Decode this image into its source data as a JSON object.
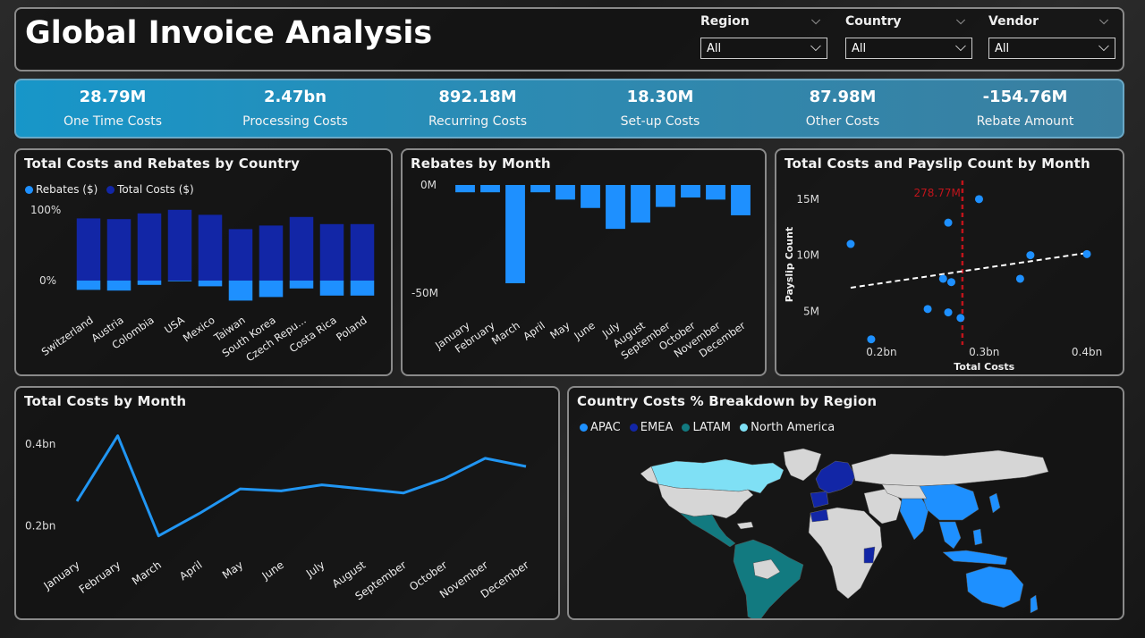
{
  "header": {
    "title": "Global Invoice Analysis",
    "slicers": [
      {
        "label": "Region",
        "value": "All"
      },
      {
        "label": "Country",
        "value": "All"
      },
      {
        "label": "Vendor",
        "value": "All"
      }
    ]
  },
  "kpis": [
    {
      "value": "28.79M",
      "label": "One Time Costs"
    },
    {
      "value": "2.47bn",
      "label": "Processing Costs"
    },
    {
      "value": "892.18M",
      "label": "Recurring Costs"
    },
    {
      "value": "18.30M",
      "label": "Set-up Costs"
    },
    {
      "value": "87.98M",
      "label": "Other Costs"
    },
    {
      "value": "-154.76M",
      "label": "Rebate Amount"
    }
  ],
  "colors": {
    "total_costs": "#1226a6",
    "rebates": "#1e90ff",
    "line": "#2196f3",
    "apac": "#1e90ff",
    "emea": "#1226a6",
    "latam": "#127a80",
    "north_america": "#7fe0f5",
    "reference_line": "#c0141b"
  },
  "chart_data": [
    {
      "type": "bar",
      "subtype": "stacked-percent",
      "title": "Total Costs and Rebates by Country",
      "categories": [
        "Switzerland",
        "Austria",
        "Colombia",
        "USA",
        "Mexico",
        "Taiwan",
        "South Korea",
        "Czech Repu...",
        "Costa Rica",
        "Poland"
      ],
      "series": [
        {
          "name": "Rebates ($)",
          "values": [
            -13,
            -14,
            -6,
            -1,
            -8,
            -28,
            -23,
            -11,
            -21,
            -21
          ]
        },
        {
          "name": "Total Costs ($)",
          "values": [
            87,
            86,
            94,
            99,
            92,
            72,
            77,
            89,
            79,
            79
          ]
        }
      ],
      "yticks": [
        "100%",
        "0%"
      ],
      "ylim": [
        -30,
        100
      ],
      "legend": "top-left"
    },
    {
      "type": "bar",
      "title": "Rebates by Month",
      "categories": [
        "January",
        "February",
        "March",
        "April",
        "May",
        "June",
        "July",
        "August",
        "September",
        "October",
        "November",
        "December"
      ],
      "values": [
        -3.5,
        -3.5,
        -47,
        -3.5,
        -7,
        -11,
        -21,
        -18,
        -10.5,
        -6,
        -7,
        -14.5
      ],
      "yticks": [
        "0M",
        "-50M"
      ],
      "ylim": [
        -50,
        0
      ]
    },
    {
      "type": "scatter",
      "title": "Total Costs and Payslip Count by Month",
      "xlabel": "Total Costs",
      "ylabel": "Payslip Count",
      "xticks": [
        "0.2bn",
        "0.3bn",
        "0.4bn"
      ],
      "yticks": [
        "15M",
        "10M",
        "5M"
      ],
      "xlim": [
        0.15,
        0.42
      ],
      "ylim": [
        2,
        16.5
      ],
      "points": [
        {
          "x": 0.17,
          "y": 11.0
        },
        {
          "x": 0.19,
          "y": 2.5
        },
        {
          "x": 0.245,
          "y": 5.2
        },
        {
          "x": 0.26,
          "y": 7.9
        },
        {
          "x": 0.265,
          "y": 4.9
        },
        {
          "x": 0.268,
          "y": 7.6
        },
        {
          "x": 0.265,
          "y": 12.9
        },
        {
          "x": 0.277,
          "y": 4.4
        },
        {
          "x": 0.295,
          "y": 15.0
        },
        {
          "x": 0.335,
          "y": 7.9
        },
        {
          "x": 0.345,
          "y": 10.0
        },
        {
          "x": 0.4,
          "y": 10.1
        }
      ],
      "trendline": [
        {
          "x": 0.17,
          "y": 7.1
        },
        {
          "x": 0.4,
          "y": 10.2
        }
      ],
      "reference_line": {
        "x": 0.2788,
        "label": "278.77M"
      }
    },
    {
      "type": "line",
      "title": "Total Costs by Month",
      "categories": [
        "January",
        "February",
        "March",
        "April",
        "May",
        "June",
        "July",
        "August",
        "September",
        "October",
        "November",
        "December"
      ],
      "values": [
        0.26,
        0.42,
        0.175,
        0.23,
        0.29,
        0.285,
        0.3,
        0.29,
        0.28,
        0.315,
        0.365,
        0.345
      ],
      "yticks": [
        "0.4bn",
        "0.2bn"
      ],
      "ylim": [
        0.1,
        0.45
      ]
    },
    {
      "type": "map",
      "title": "Country Costs % Breakdown by Region",
      "legend": [
        "APAC",
        "EMEA",
        "LATAM",
        "North America"
      ]
    }
  ]
}
